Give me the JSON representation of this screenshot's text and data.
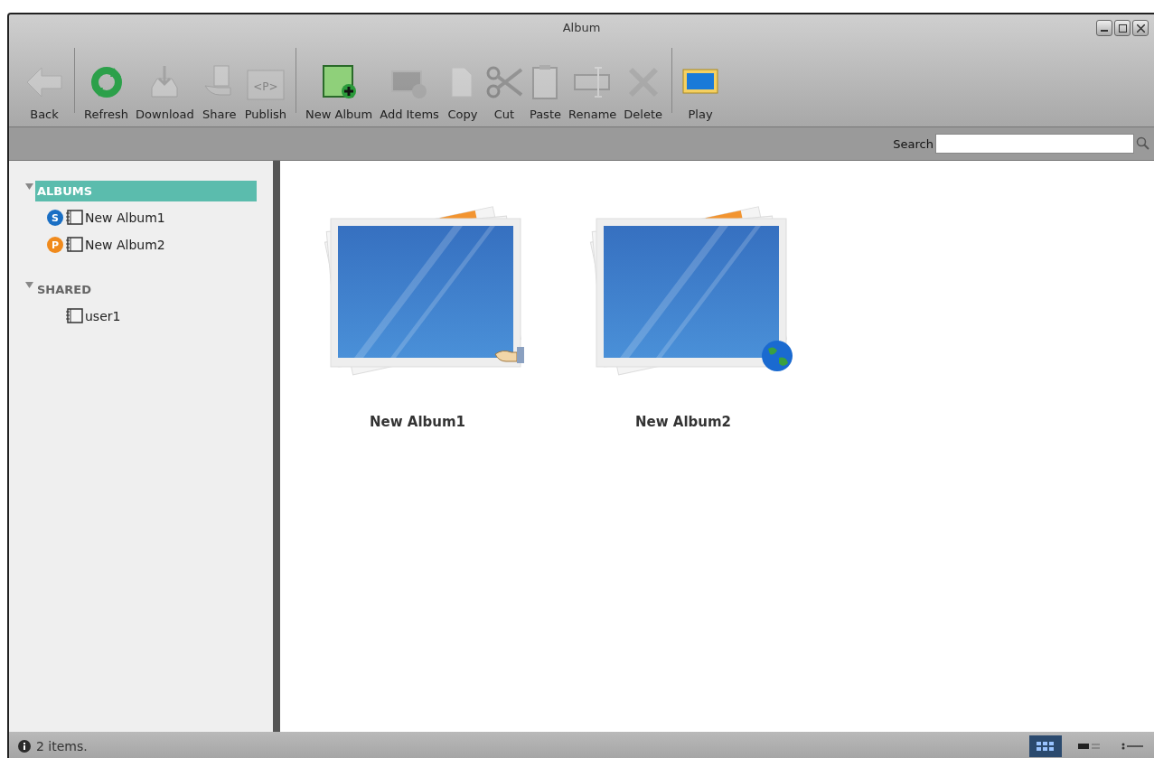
{
  "window": {
    "title": "Album"
  },
  "toolbar": [
    [
      {
        "kind": "back",
        "label": "Back",
        "disabled": true
      }
    ],
    [
      {
        "kind": "refresh",
        "label": "Refresh",
        "disabled": false
      },
      {
        "kind": "download",
        "label": "Download",
        "disabled": true
      },
      {
        "kind": "share",
        "label": "Share",
        "disabled": true
      },
      {
        "kind": "publish",
        "label": "Publish",
        "disabled": true,
        "icon_text": "<P>"
      }
    ],
    [
      {
        "kind": "new-album",
        "label": "New Album",
        "disabled": false
      },
      {
        "kind": "add",
        "label": "Add Items",
        "disabled": true
      },
      {
        "kind": "copy",
        "label": "Copy",
        "disabled": true
      },
      {
        "kind": "cut",
        "label": "Cut",
        "disabled": true
      },
      {
        "kind": "paste",
        "label": "Paste",
        "disabled": true
      },
      {
        "kind": "rename",
        "label": "Rename",
        "disabled": true
      },
      {
        "kind": "delete",
        "label": "Delete",
        "disabled": true
      }
    ],
    [
      {
        "kind": "play",
        "label": "Play",
        "disabled": false
      }
    ]
  ],
  "search": {
    "label": "Search"
  },
  "tree": [
    {
      "label": "ALBUMS",
      "expanded": true,
      "selected": true,
      "children": [
        {
          "label": "New Album1",
          "badge": "S",
          "color": "#1a6fc4"
        },
        {
          "label": "New Album2",
          "badge": "P",
          "color": "#f08a1c"
        }
      ]
    },
    {
      "label": "SHARED",
      "expanded": true,
      "selected": false,
      "children": [
        {
          "label": "user1"
        }
      ]
    }
  ],
  "albums": [
    {
      "name": "New Album1",
      "kind": "shared"
    },
    {
      "name": "New Album2",
      "kind": "published"
    }
  ],
  "status_bar": {
    "text": "2 items.",
    "views": [
      {
        "kind": "grid",
        "selected": true
      },
      {
        "kind": "list",
        "selected": false
      },
      {
        "kind": "detail",
        "selected": false
      }
    ]
  }
}
